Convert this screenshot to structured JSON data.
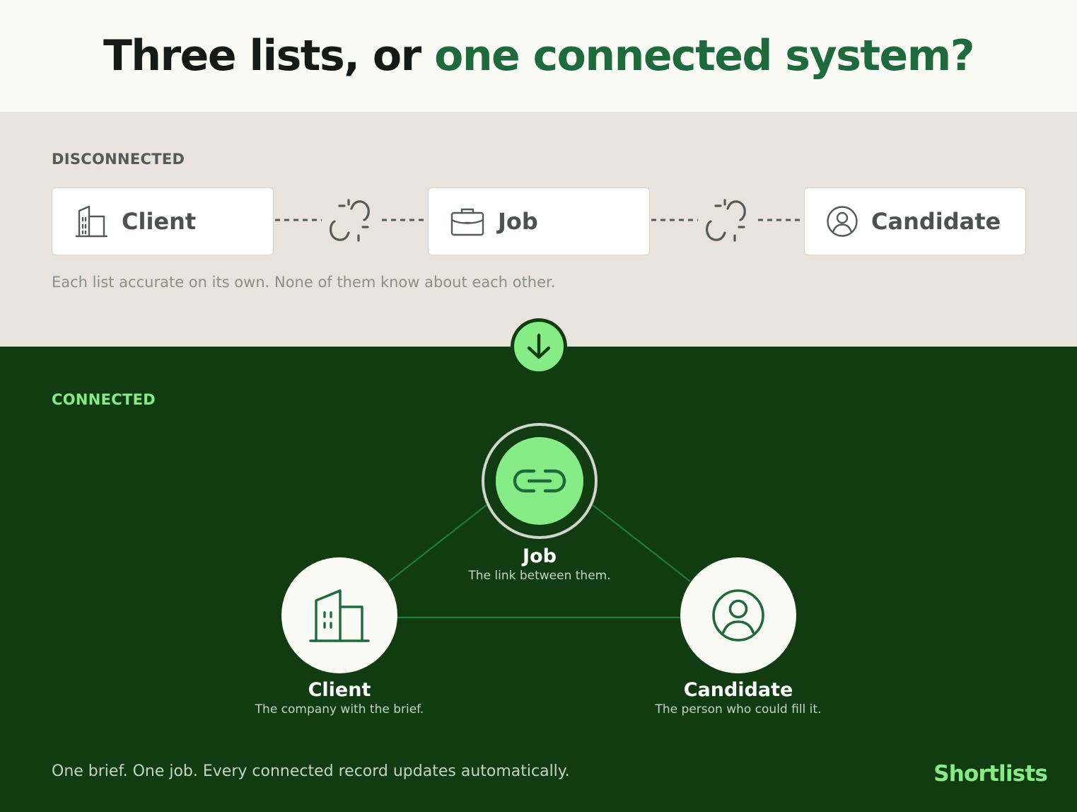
{
  "header": {
    "title_plain": "Three lists, or ",
    "title_accent": "one connected system?"
  },
  "disconnected": {
    "section_label": "DISCONNECTED",
    "cards": [
      {
        "label": "Client",
        "icon": "building-icon"
      },
      {
        "label": "Job",
        "icon": "briefcase-icon"
      },
      {
        "label": "Candidate",
        "icon": "user-circle-icon"
      }
    ],
    "connector_icon": "broken-link-icon",
    "caption": "Each list accurate on its own. None of them know about each other."
  },
  "transition_icon": "arrow-down-icon",
  "connected": {
    "section_label": "CONNECTED",
    "nodes": {
      "job": {
        "title": "Job",
        "description": "The link between them.",
        "icon": "link-icon"
      },
      "client": {
        "title": "Client",
        "description": "The company with the brief.",
        "icon": "building-icon"
      },
      "candidate": {
        "title": "Candidate",
        "description": "The person who could fill it.",
        "icon": "user-circle-icon"
      }
    }
  },
  "footer": {
    "text": "One brief. One job. Every connected record updates automatically.",
    "brand": "Shortlists"
  },
  "colors": {
    "accent_green": "#1d6b3c",
    "light_green": "#86ec86",
    "dark_green": "#113c12",
    "beige": "#e8e3dd",
    "cream": "#fbfbf6"
  }
}
